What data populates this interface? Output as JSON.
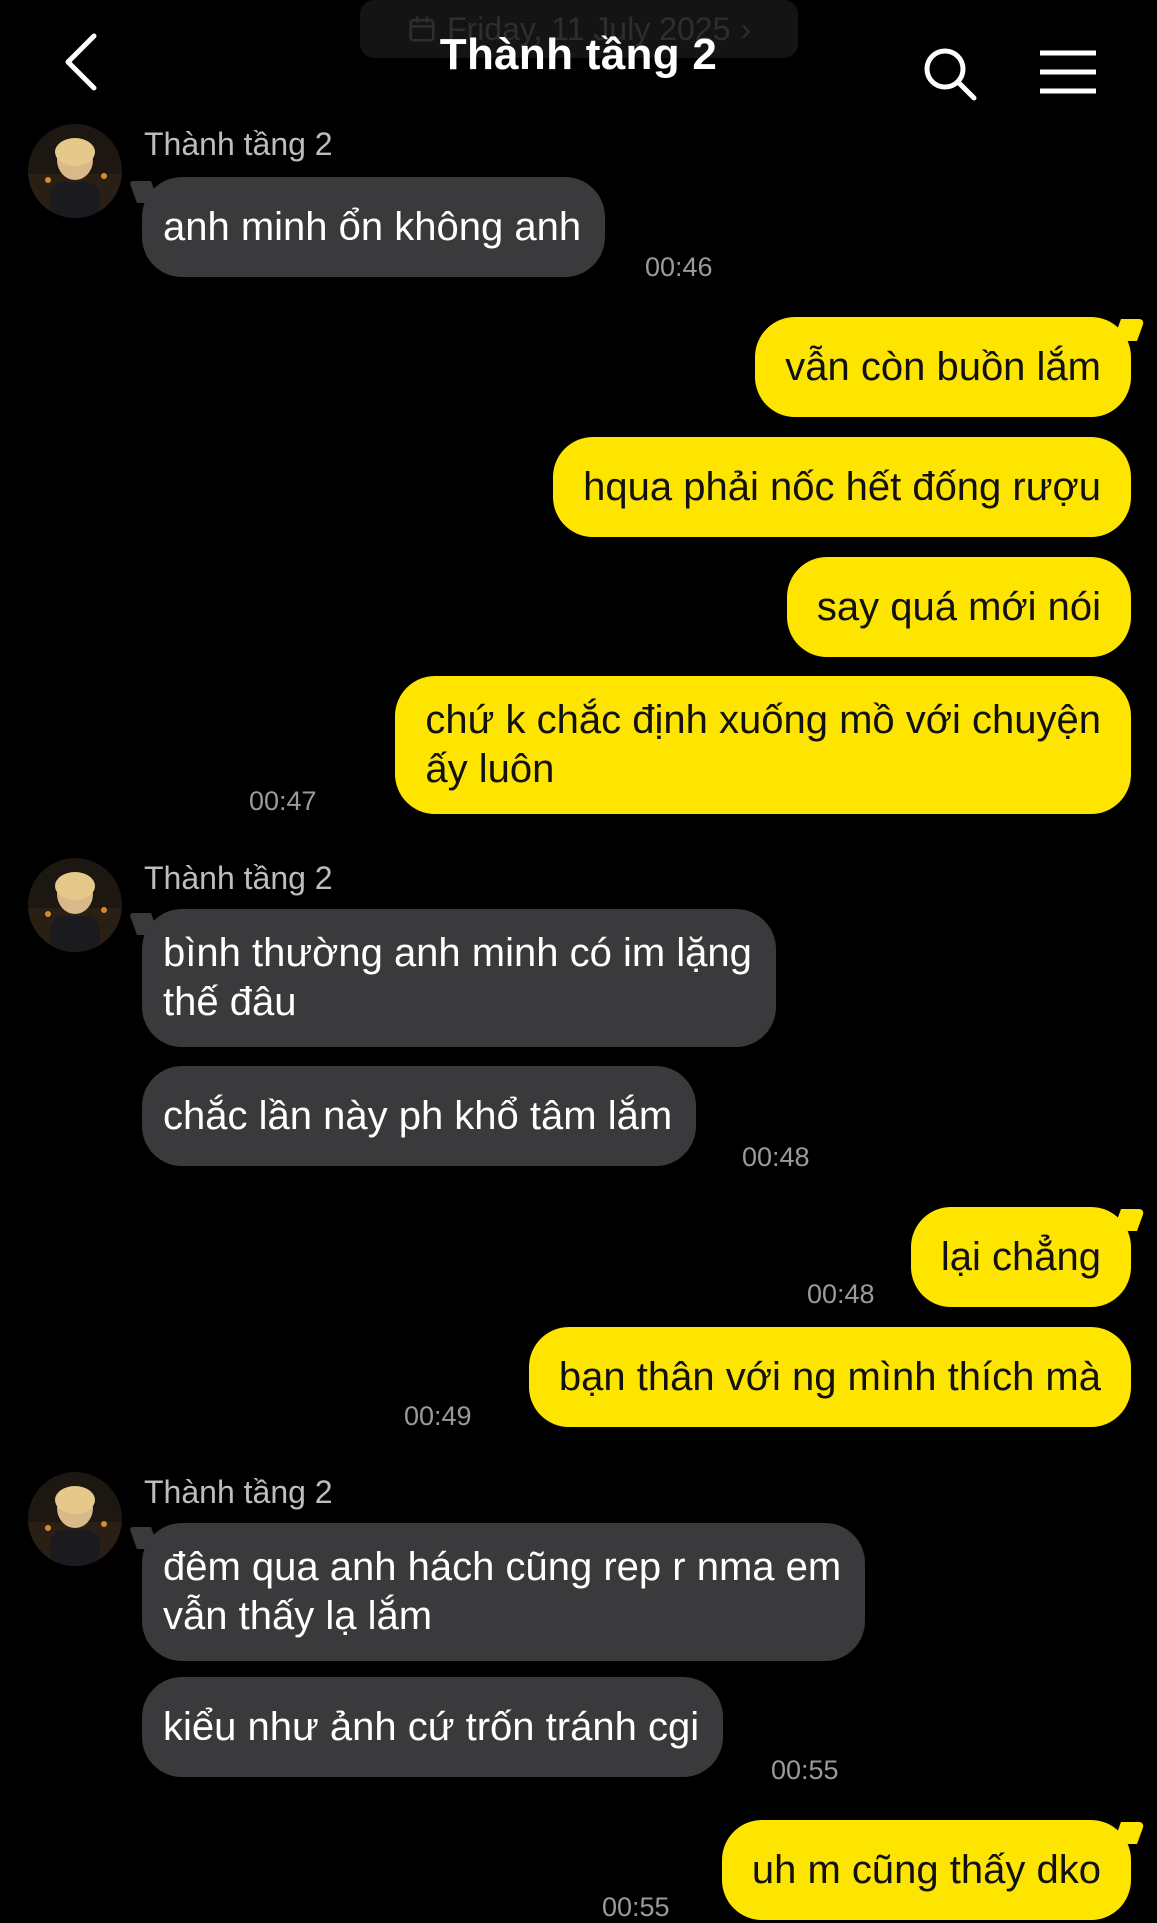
{
  "header": {
    "date_label": "Friday, 11 July 2025",
    "title": "Thành tầng 2",
    "back_icon": "chevron-left-icon",
    "search_icon": "search-icon",
    "menu_icon": "hamburger-menu-icon"
  },
  "colors": {
    "background": "#000000",
    "incoming_bubble": "#3a3a3c",
    "outgoing_bubble": "#fee500",
    "timestamp": "#9a9a9a"
  },
  "messages": [
    {
      "sender": "Thành tầng 2",
      "text": "anh minh ổn không anh",
      "time": "00:46"
    },
    {
      "text": "vẫn còn buồn lắm"
    },
    {
      "text": "hqua phải nốc hết đống rượu"
    },
    {
      "text": "say quá mới nói"
    },
    {
      "text_line1": "chứ k chắc định xuống mồ với chuyện",
      "text_line2": "ấy luôn",
      "time": "00:47"
    },
    {
      "sender": "Thành tầng 2",
      "text_line1": "bình thường anh minh có im lặng",
      "text_line2": "thế đâu"
    },
    {
      "text": "chắc lần này ph khổ tâm lắm",
      "time": "00:48"
    },
    {
      "text": "lại chẳng",
      "time": "00:48"
    },
    {
      "text": "bạn thân với ng mình thích mà",
      "time": "00:49"
    },
    {
      "sender": "Thành tầng 2",
      "text_line1": "đêm qua anh hách cũng rep r nma em",
      "text_line2": "vẫn thấy lạ lắm"
    },
    {
      "text": "kiểu như ảnh cứ trốn tránh cgi",
      "time": "00:55"
    },
    {
      "text": "uh m cũng thấy dko",
      "time": "00:55"
    }
  ]
}
